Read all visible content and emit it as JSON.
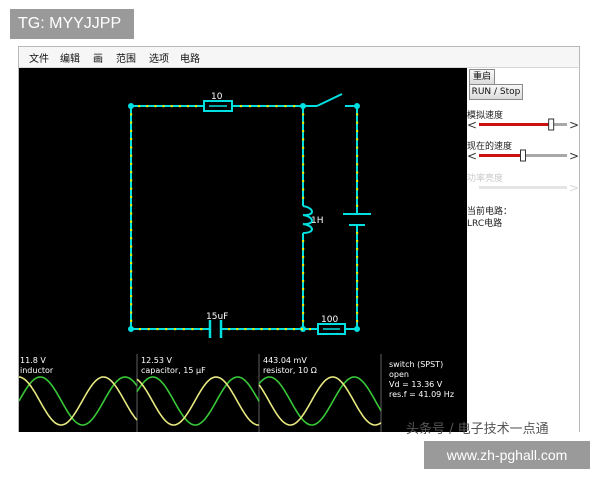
{
  "overlay": {
    "tag": "TG: MYYJJPP",
    "watermark": "头条号 / 电子技术一点通",
    "url": "www.zh-pghall.com"
  },
  "menu": [
    "文件",
    "编辑",
    "画",
    "范围",
    "选项",
    "电路"
  ],
  "panel": {
    "reset_label": "重启",
    "run_label": "RUN / Stop",
    "sim_speed_label": "模拟速度",
    "current_speed_label": "现在的速度",
    "power_brightness_label": "功率亮度",
    "current_circuit_title": "当前电路：",
    "current_circuit_name": "LRC电路",
    "sim_speed_level": 0.82,
    "current_speed_level": 0.5
  },
  "circuit": {
    "resistor_top_label": "10",
    "resistor_bottom_label": "100",
    "inductor_label": "1H",
    "capacitor_label": "15uF",
    "wire_color": "#00e0e0",
    "dot_color": "#e8e800"
  },
  "scopes": [
    {
      "value": "11.8 V",
      "name": "inductor"
    },
    {
      "value": "12.53 V",
      "name": "capacitor, 15 µF"
    },
    {
      "value": "443.04 mV",
      "name": "resistor, 10 Ω"
    }
  ],
  "switch_info": {
    "title": "switch (SPST)",
    "state": "open",
    "vd": "Vd = 13.36 V",
    "resf": "res.f = 41.09 Hz"
  },
  "colors": {
    "trace_green": "#38c838",
    "trace_yellow": "#e8e880"
  }
}
